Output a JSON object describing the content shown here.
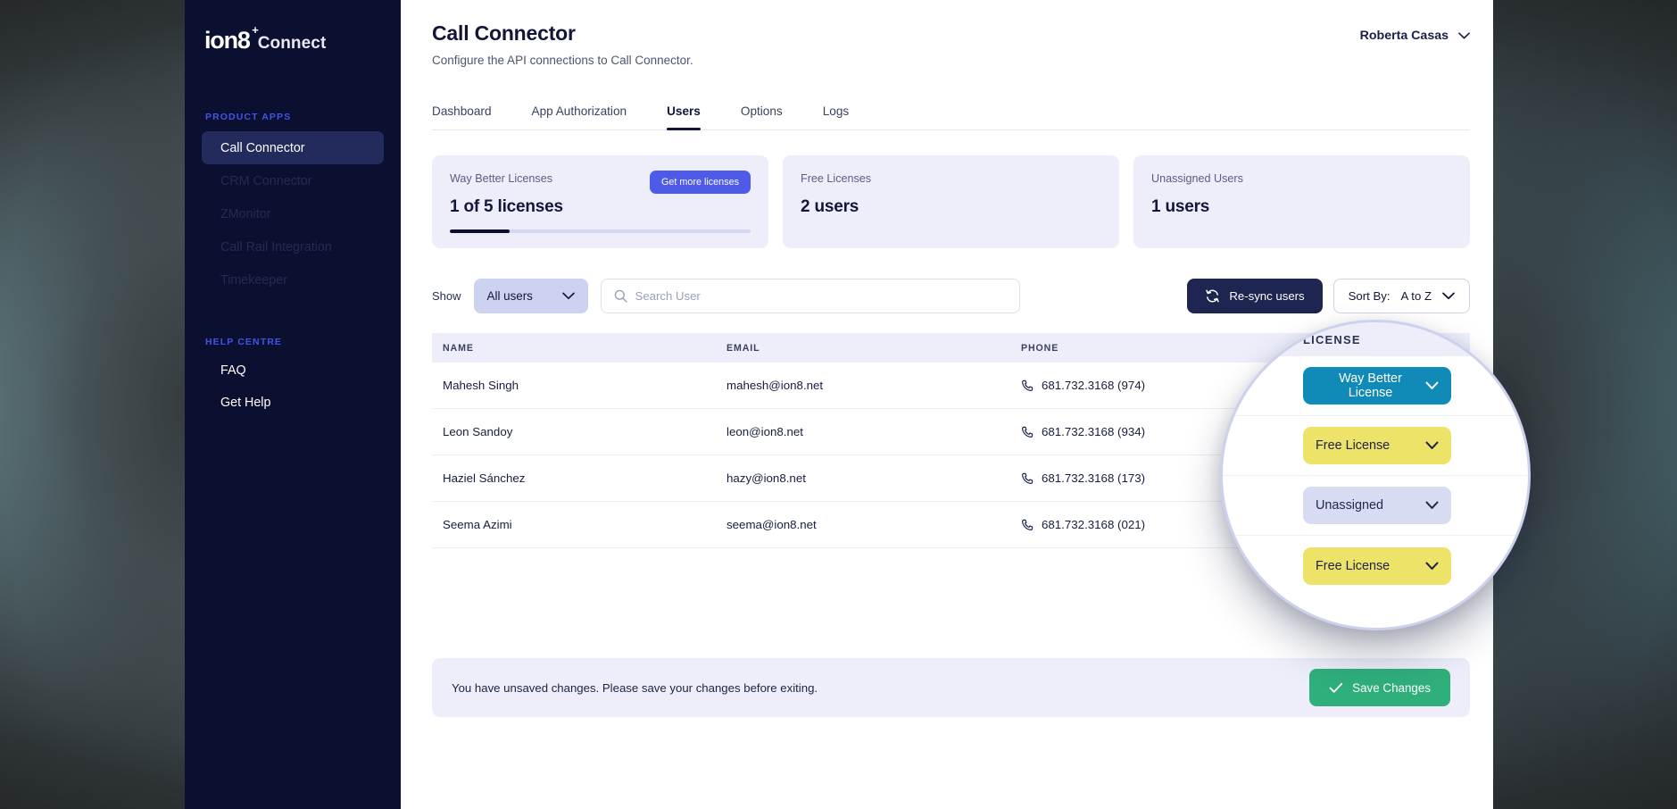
{
  "brand": {
    "logo": "ion8",
    "plus": "+",
    "name": "Connect"
  },
  "sidebar": {
    "section_products": "PRODUCT APPS",
    "products": [
      {
        "label": "Call Connector",
        "active": true
      },
      {
        "label": "CRM Connector",
        "active": false
      },
      {
        "label": "ZMonitor",
        "active": false
      },
      {
        "label": "Call Rail Integration",
        "active": false
      },
      {
        "label": "Timekeeper",
        "active": false
      }
    ],
    "section_help": "HELP CENTRE",
    "help": [
      {
        "label": "FAQ"
      },
      {
        "label": "Get Help"
      }
    ]
  },
  "header": {
    "title": "Call Connector",
    "subtitle": "Configure the API connections to Call Connector.",
    "user": "Roberta Casas"
  },
  "tabs": [
    {
      "label": "Dashboard",
      "active": false
    },
    {
      "label": "App Authorization",
      "active": false
    },
    {
      "label": "Users",
      "active": true
    },
    {
      "label": "Options",
      "active": false
    },
    {
      "label": "Logs",
      "active": false
    }
  ],
  "cards": {
    "way_better": {
      "label": "Way Better Licenses",
      "value": "1 of 5 licenses",
      "button": "Get more licenses",
      "progress_percent": 20
    },
    "free": {
      "label": "Free Licenses",
      "value": "2 users"
    },
    "unassigned": {
      "label": "Unassigned Users",
      "value": "1 users"
    }
  },
  "toolbar": {
    "show_label": "Show",
    "filter_value": "All users",
    "search_placeholder": "Search User",
    "search_value": "",
    "resync_label": "Re-sync users",
    "sort_label": "Sort By:",
    "sort_value": "A to Z"
  },
  "table": {
    "columns": [
      "NAME",
      "EMAIL",
      "PHONE",
      "LICENSE"
    ],
    "rows": [
      {
        "name": "Mahesh Singh",
        "email": "mahesh@ion8.net",
        "phone": "681.732.3168 (974)",
        "license": "Way Better License",
        "license_type": "way"
      },
      {
        "name": "Leon Sandoy",
        "email": "leon@ion8.net",
        "phone": "681.732.3168 (934)",
        "license": "Free License",
        "license_type": "free"
      },
      {
        "name": "Haziel Sánchez",
        "email": "hazy@ion8.net",
        "phone": "681.732.3168 (173)",
        "license": "Unassigned",
        "license_type": "un"
      },
      {
        "name": "Seema Azimi",
        "email": "seema@ion8.net",
        "phone": "681.732.3168 (021)",
        "license": "Free License",
        "license_type": "free"
      }
    ]
  },
  "magnifier": {
    "header": "LICENSE",
    "pills": [
      "Way Better License",
      "Free License",
      "Unassigned",
      "Free License"
    ]
  },
  "savebar": {
    "message": "You have unsaved changes. Please save your changes before exiting.",
    "button": "Save Changes"
  },
  "colors": {
    "sidebar_bg": "#0c1030",
    "accent_blue": "#4e5ae8",
    "license_way_better": "#118ab8",
    "license_free": "#ece368",
    "license_unassigned": "#d8dcf2",
    "save_green": "#2fb07a",
    "card_bg": "#edeefa"
  }
}
